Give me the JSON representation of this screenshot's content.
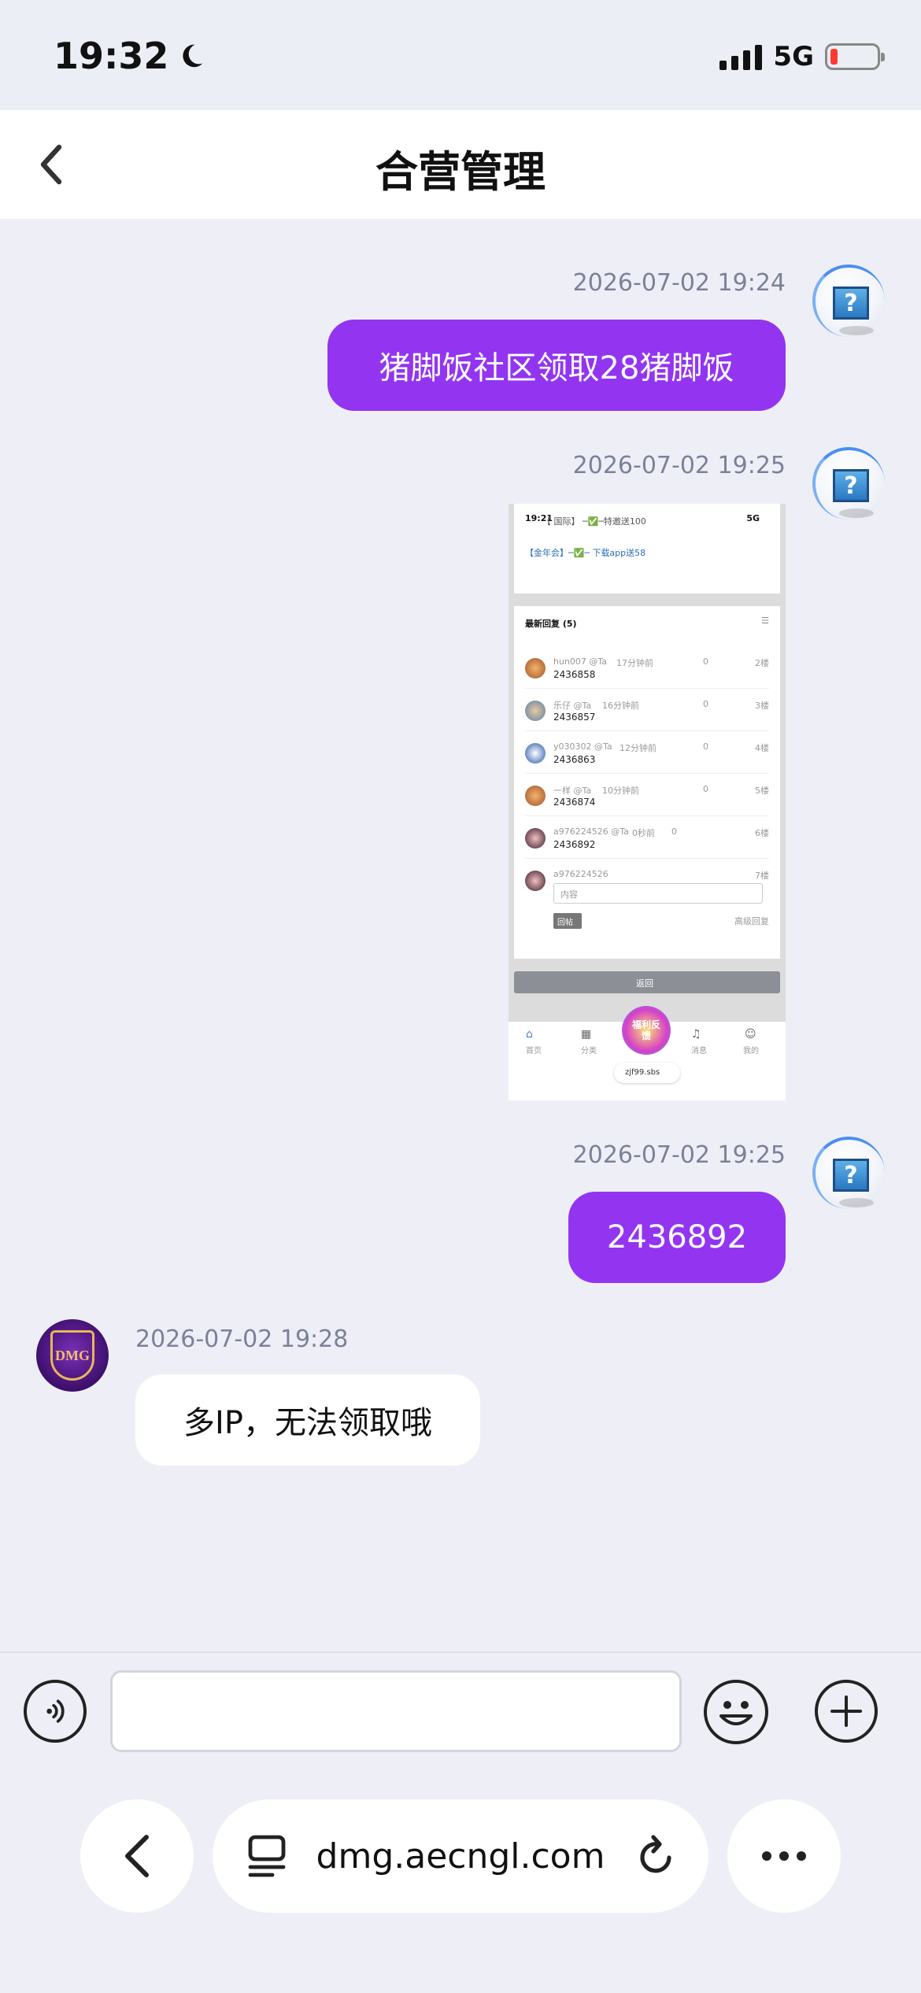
{
  "status_bar": {
    "time": "19:32",
    "network": "5G"
  },
  "nav": {
    "title": "合营管理"
  },
  "messages": [
    {
      "side": "right",
      "timestamp": "2026-07-02 19:24",
      "text": "猪脚饭社区领取28猪脚饭"
    },
    {
      "side": "right",
      "timestamp": "2026-07-02 19:25",
      "type": "image"
    },
    {
      "side": "right",
      "timestamp": "2026-07-02 19:25",
      "text": "2436892"
    },
    {
      "side": "left",
      "timestamp": "2026-07-02 19:28",
      "text": "多IP，无法领取哦"
    }
  ],
  "avatars": {
    "question_mark": "?",
    "agent_logo": "DMG"
  },
  "screenshot": {
    "time": "19:21",
    "network": "5G",
    "promo_1": "【 国际】 ─✅─特邀送100",
    "promo_2": "【金年会】─✅─ 下载app送58",
    "replies_title": "最新回复 (5)",
    "replies": [
      {
        "user": "hun007 @Ta",
        "ago": "17分钟前",
        "likes": "0",
        "floor": "2楼",
        "content": "2436858"
      },
      {
        "user": "乐仔 @Ta",
        "ago": "16分钟前",
        "likes": "0",
        "floor": "3楼",
        "content": "2436857"
      },
      {
        "user": "y030302 @Ta",
        "ago": "12分钟前",
        "likes": "0",
        "floor": "4楼",
        "content": "2436863"
      },
      {
        "user": "一样 @Ta",
        "ago": "10分钟前",
        "likes": "0",
        "floor": "5楼",
        "content": "2436874"
      },
      {
        "user": "a976224526 @Ta",
        "ago": "0秒前",
        "likes": "0",
        "floor": "6楼",
        "content": "2436892"
      }
    ],
    "reply_form": {
      "user": "a976224526",
      "floor": "7楼",
      "placeholder": "内容",
      "submit": "回帖",
      "advanced": "高级回复"
    },
    "back_button": "返回",
    "tab_home": "首页",
    "tab_category": "分类",
    "center_badge": "福利反馈",
    "tab_messages": "消息",
    "tab_mine": "我的",
    "url": "zjf99.sbs"
  },
  "input": {
    "placeholder": ""
  },
  "browser": {
    "url": "dmg.aecngl.com"
  },
  "colors": {
    "bubble_right": "#9335f0",
    "bubble_left": "#ffffff",
    "background": "#eeeff6",
    "timestamp": "#7b8198"
  }
}
